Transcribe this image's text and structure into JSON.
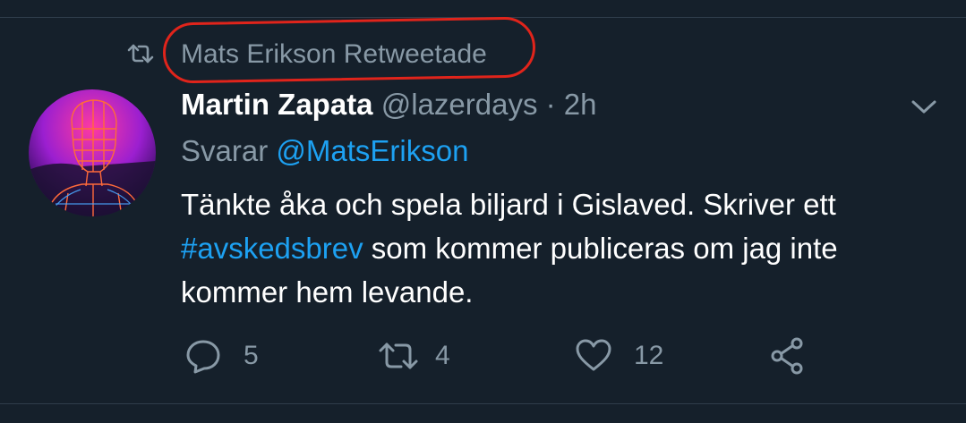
{
  "retweet": {
    "label": "Mats Erikson Retweetade"
  },
  "tweet": {
    "author_name": "Martin Zapata",
    "author_handle": "@lazerdays",
    "separator": "·",
    "time": "2h",
    "reply_prefix": "Svarar",
    "reply_to": "@MatsErikson",
    "text_part1": "Tänkte åka och spela biljard i Gislaved. Skriver ett",
    "hashtag": "#avskedsbrev",
    "text_part2": "som kommer publiceras om jag inte kommer hem levande."
  },
  "actions": {
    "reply_count": "5",
    "retweet_count": "4",
    "like_count": "12"
  },
  "colors": {
    "background": "#15202b",
    "secondary_text": "#8899a6",
    "link": "#1da1f2",
    "annotation_oval": "#e0241b"
  },
  "icons": [
    "retweet-icon",
    "chevron-down-icon",
    "reply-icon",
    "like-icon",
    "share-icon"
  ]
}
